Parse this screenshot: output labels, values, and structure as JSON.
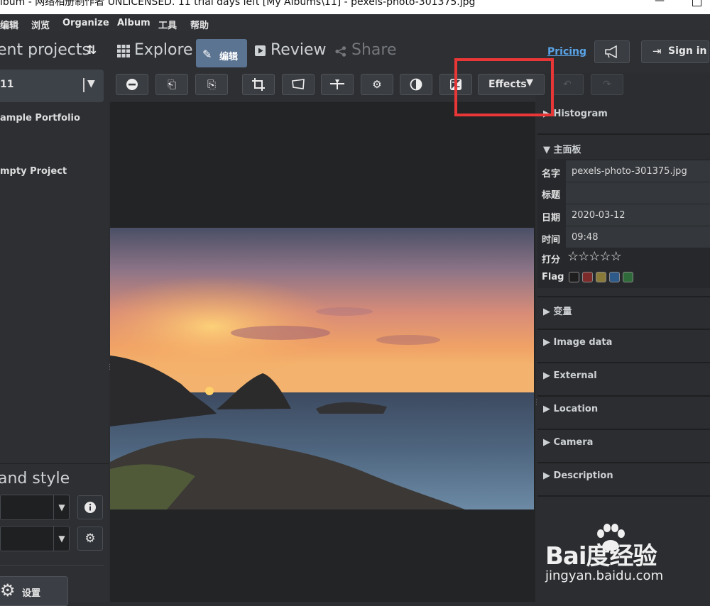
{
  "window": {
    "title": "lbum - 网络相册制作者 UNLICENSED. 11 trial days left [My Albums\\11] - pexels-photo-301375.jpg",
    "minimize": "—"
  },
  "menu": [
    "编辑",
    "浏览",
    "Organize",
    "Album",
    "工具",
    "帮助"
  ],
  "left_panel": {
    "title": "ent projects",
    "selected_project": "11",
    "projects": [
      "ample Portfolio",
      "mpty Project"
    ],
    "style_title": "and style",
    "settings_label": "设置"
  },
  "tabs": {
    "explore": "Explore",
    "edit": "编辑",
    "review": "Review",
    "share": "Share"
  },
  "header": {
    "pricing": "Pricing",
    "sign_in": "Sign in"
  },
  "toolbar": {
    "effects": "Effects"
  },
  "right_panel": {
    "sections_top": [
      "Histogram"
    ],
    "main_panel_title": "主面板",
    "fields": [
      {
        "label": "名字",
        "value": "pexels-photo-301375.jpg"
      },
      {
        "label": "标题",
        "value": ""
      },
      {
        "label": "日期",
        "value": "2020-03-12"
      },
      {
        "label": "时间",
        "value": "09:48"
      }
    ],
    "rating_label": "打分",
    "rating": 0,
    "flag_label": "Flag",
    "flag_colors": [
      "#1e1e1e",
      "#7d2a2a",
      "#8a7a3a",
      "#2e5a8a",
      "#2f6a3a"
    ],
    "sections": [
      "变量",
      "Image data",
      "External",
      "Location",
      "Camera",
      "Description"
    ]
  },
  "watermark": {
    "logo": "Bai度经验",
    "url": "jingyan.baidu.com"
  },
  "colors": {
    "accent_tab": "#5b7492",
    "link": "#5aa4e8",
    "highlight_box": "#e93636"
  }
}
